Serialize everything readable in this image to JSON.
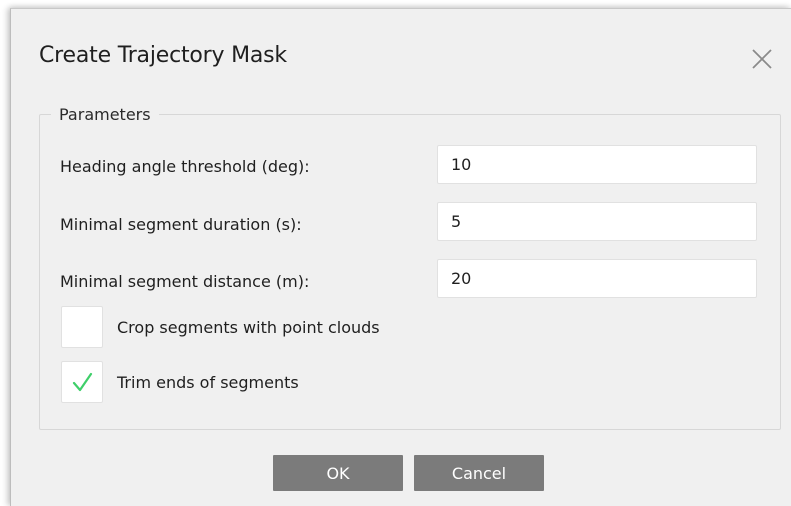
{
  "dialog": {
    "title": "Create Trajectory Mask",
    "close_icon": "close-icon"
  },
  "parameters": {
    "legend": "Parameters",
    "fields": [
      {
        "label": "Heading angle threshold (deg):",
        "value": "10"
      },
      {
        "label": "Minimal segment duration (s):",
        "value": "5"
      },
      {
        "label": "Minimal segment distance (m):",
        "value": "20"
      }
    ],
    "checkboxes": [
      {
        "label": "Crop segments with point clouds",
        "checked": false
      },
      {
        "label": "Trim ends of segments",
        "checked": true
      }
    ]
  },
  "buttons": {
    "ok_label": "OK",
    "cancel_label": "Cancel"
  },
  "colors": {
    "check_mark": "#3fcf6a",
    "button_bg": "#7b7b7b",
    "dialog_bg": "#f0f0f0"
  }
}
